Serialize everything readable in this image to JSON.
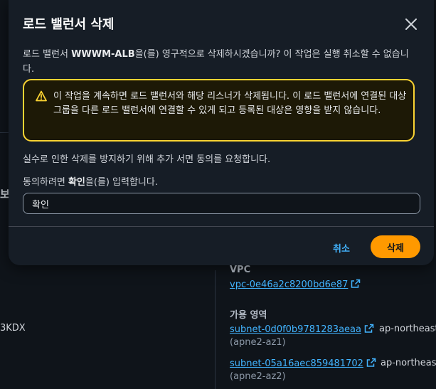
{
  "modal": {
    "title": "로드 밸런서 삭제",
    "body_prefix": "로드 밸런서 ",
    "load_balancer_name": "WWWM-ALB",
    "body_suffix": "을(를) 영구적으로 삭제하시겠습니까? 이 작업은 실행 취소할 수 없습니다.",
    "alert_text": "이 작업을 계속하면 로드 밸런서와 해당 리스너가 삭제됩니다. 이 로드 밸런서에 연결된 대상 그룹을 다른 로드 밸런서에 연결할 수 있게 되고 등록된 대상은 영향을 받지 않습니다.",
    "request_text": "실수로 인한 삭제를 방지하기 위해 추가 서면 동의를 요청합니다.",
    "field_label_prefix": "동의하려면 ",
    "field_label_keyword": "확인",
    "field_label_suffix": "을(를) 입력합니다.",
    "input_value": "확인",
    "cancel_label": "취소",
    "delete_label": "삭제"
  },
  "background": {
    "cut_label": "보",
    "cut_value": "3KDX",
    "vpc_label": "VPC",
    "vpc_link": "vpc-0e46a2c8200bd6e87",
    "az_label": "가용 영역",
    "subnets": [
      {
        "id": "subnet-0d0f0b9781283aeaa",
        "region": "ap-northeast",
        "zone": "(apne2-az1)"
      },
      {
        "id": "subnet-05a16aec859481702",
        "region": "ap-northeast",
        "zone": "(apne2-az2)"
      }
    ]
  },
  "colors": {
    "background": "#0f141a",
    "modal": "#161d26",
    "primary_button": "#ff9900",
    "link": "#42b4ff",
    "warning_border": "#fbd332",
    "warning_bg": "#1d1906"
  },
  "icons": [
    "close-icon",
    "warning-icon",
    "external-link-icon"
  ]
}
